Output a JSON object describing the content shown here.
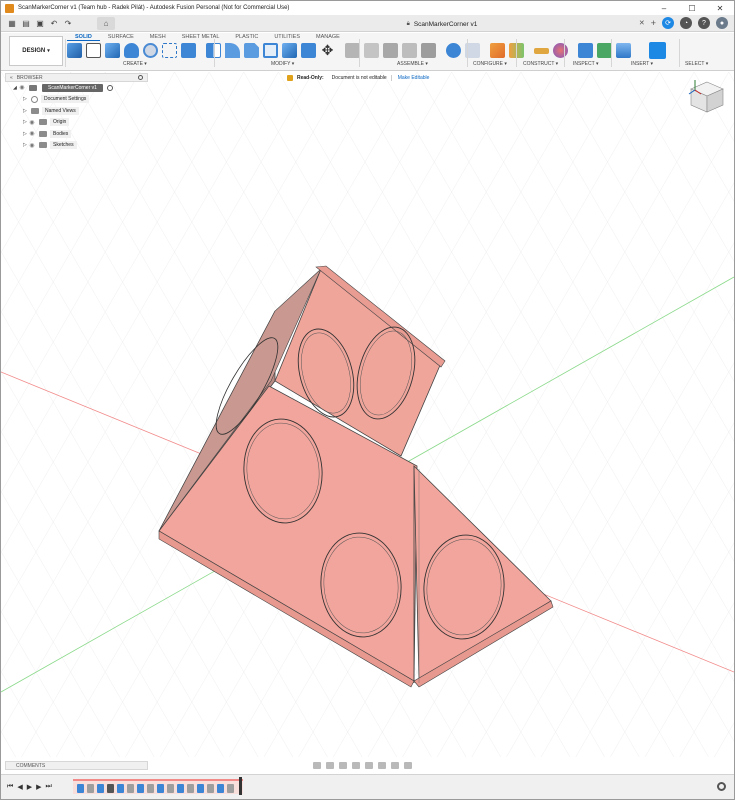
{
  "window": {
    "title": "ScanMarkerCorner v1 (Team hub - Radek Pilát) - Autodesk Fusion Personal (Not for Commercial Use)",
    "controls": [
      "–",
      "☐",
      "✕"
    ]
  },
  "document_tab": {
    "name": "ScanMarkerCorner v1"
  },
  "workspace": {
    "label": "DESIGN"
  },
  "ribbon_tabs": [
    {
      "label": "SOLID",
      "active": true
    },
    {
      "label": "SURFACE",
      "active": false
    },
    {
      "label": "MESH",
      "active": false
    },
    {
      "label": "SHEET METAL",
      "active": false
    },
    {
      "label": "PLASTIC",
      "active": false
    },
    {
      "label": "UTILITIES",
      "active": false
    },
    {
      "label": "MANAGE",
      "active": false
    }
  ],
  "tool_groups": [
    {
      "label": "CREATE ▾"
    },
    {
      "label": "MODIFY ▾"
    },
    {
      "label": "ASSEMBLE ▾"
    },
    {
      "label": "CONFIGURE ▾"
    },
    {
      "label": "CONSTRUCT ▾"
    },
    {
      "label": "INSPECT ▾"
    },
    {
      "label": "INSERT ▾"
    },
    {
      "label": "SELECT ▾"
    }
  ],
  "browser": {
    "header": "BROWSER",
    "root": "ScanMarkerCorner v1",
    "items": [
      {
        "label": "Document Settings",
        "icon": "gear-icon"
      },
      {
        "label": "Named Views",
        "icon": "folder-icon"
      },
      {
        "label": "Origin",
        "icon": "folder-icon"
      },
      {
        "label": "Bodies",
        "icon": "folder-icon"
      },
      {
        "label": "Sketches",
        "icon": "folder-icon"
      }
    ]
  },
  "readonly_bar": {
    "status": "Read-Only:",
    "message": "Document is not editable",
    "action": "Make Editable"
  },
  "comments": {
    "label": "COMMENTS"
  },
  "colors": {
    "accent": "#0a66c2",
    "body_face_main": "#f2a59c",
    "body_face_side": "#e89c92",
    "body_face_dark": "#b88a84",
    "grid_x_axis": "#f28a8a",
    "grid_y_axis": "#8ad98a",
    "readonly_lock": "#e1a21b"
  }
}
